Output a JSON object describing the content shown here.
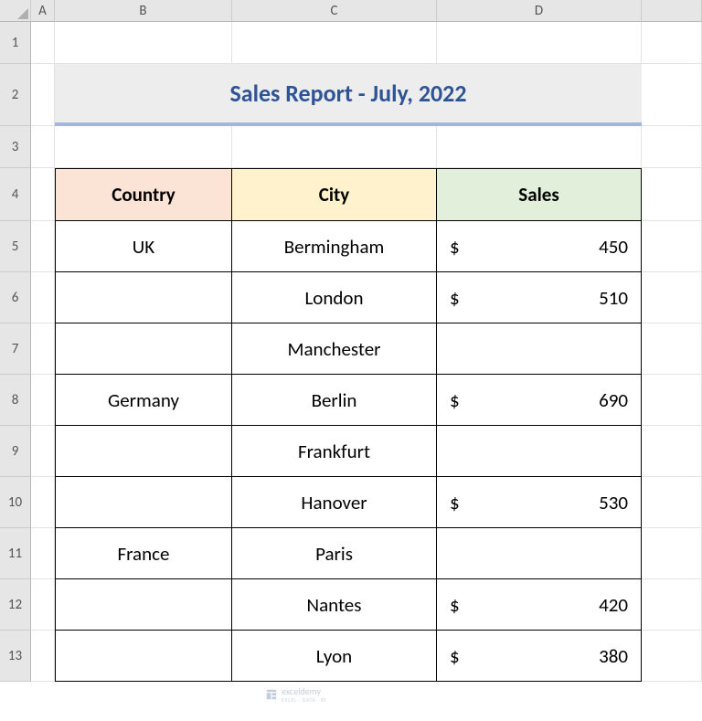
{
  "columns": [
    "A",
    "B",
    "C",
    "D"
  ],
  "row_numbers": [
    "1",
    "2",
    "3",
    "4",
    "5",
    "6",
    "7",
    "8",
    "9",
    "10",
    "11",
    "12",
    "13"
  ],
  "title": "Sales Report - July, 2022",
  "headers": {
    "country": "Country",
    "city": "City",
    "sales": "Sales"
  },
  "currency": "$",
  "rows": [
    {
      "country": "UK",
      "city": "Bermingham",
      "sales": "450"
    },
    {
      "country": "",
      "city": "London",
      "sales": "510"
    },
    {
      "country": "",
      "city": "Manchester",
      "sales": ""
    },
    {
      "country": "Germany",
      "city": "Berlin",
      "sales": "690"
    },
    {
      "country": "",
      "city": "Frankfurt",
      "sales": ""
    },
    {
      "country": "",
      "city": "Hanover",
      "sales": "530"
    },
    {
      "country": "France",
      "city": "Paris",
      "sales": ""
    },
    {
      "country": "",
      "city": "Nantes",
      "sales": "420"
    },
    {
      "country": "",
      "city": "Lyon",
      "sales": "380"
    }
  ],
  "watermark": {
    "brand": "exceldemy",
    "tag": "EXCEL · DATA · BI"
  }
}
